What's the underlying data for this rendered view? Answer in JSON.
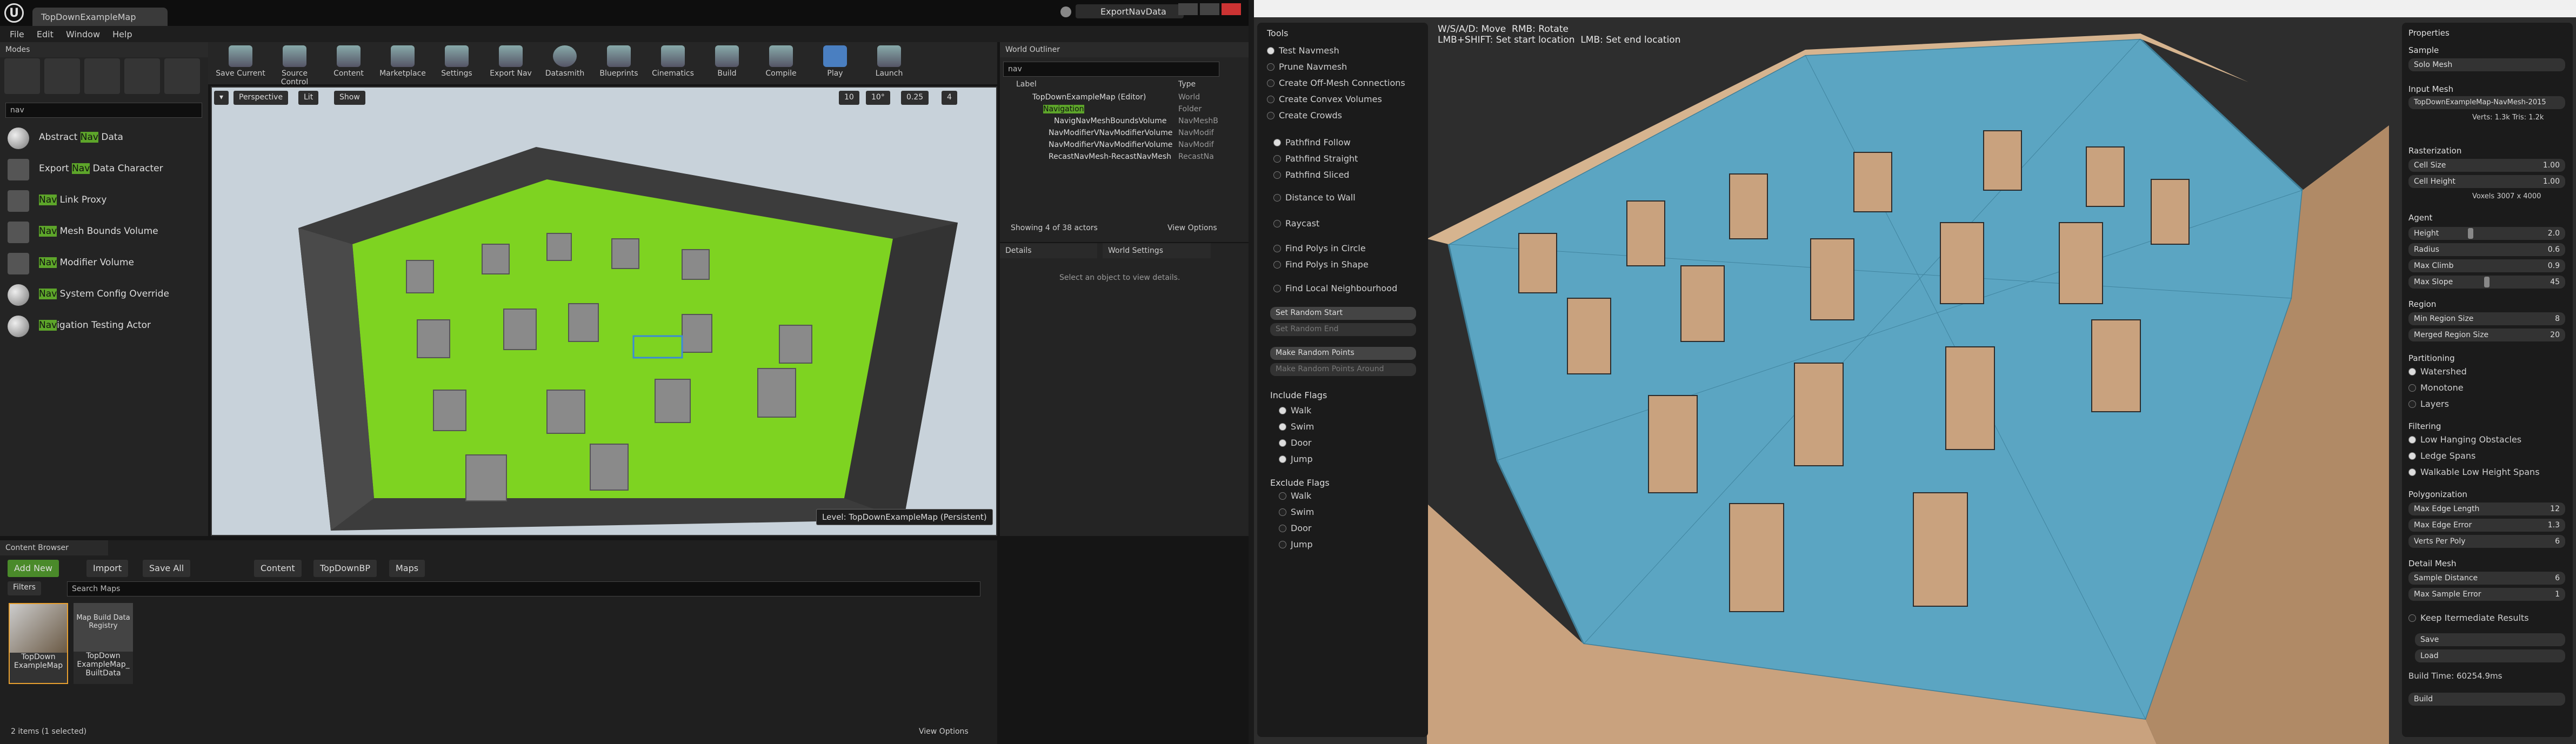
{
  "ue": {
    "tab": "TopDownExampleMap",
    "export_window": "ExportNavData",
    "menu": [
      "File",
      "Edit",
      "Window",
      "Help"
    ],
    "modes": {
      "title": "Modes",
      "search": "nav",
      "items": [
        {
          "pre": "Abstract ",
          "hl": "Nav",
          "post": " Data"
        },
        {
          "pre": "Export ",
          "hl": "Nav",
          "post": " Data Character"
        },
        {
          "pre": "",
          "hl": "Nav",
          "post": " Link Proxy"
        },
        {
          "pre": "",
          "hl": "Nav",
          "post": " Mesh Bounds Volume"
        },
        {
          "pre": "",
          "hl": "Nav",
          "post": " Modifier Volume"
        },
        {
          "pre": "",
          "hl": "Nav",
          "post": " System Config Override"
        },
        {
          "pre": "",
          "hl": "Nav",
          "post": "igation Testing Actor"
        }
      ]
    },
    "toolbar": [
      "Save Current",
      "Source Control",
      "Content",
      "Marketplace",
      "Settings",
      "Export Nav",
      "Datasmith",
      "Blueprints",
      "Cinematics",
      "Build",
      "Compile",
      "Play",
      "Launch"
    ],
    "viewport": {
      "perspective": "Perspective",
      "lit": "Lit",
      "show": "Show",
      "grid": "10",
      "angle": "10°",
      "scale": "0.25",
      "cam": "4",
      "level": "Level: TopDownExampleMap (Persistent)"
    },
    "outliner": {
      "title": "World Outliner",
      "search": "nav",
      "col_label": "Label",
      "col_type": "Type",
      "rows": [
        {
          "label": "TopDownExampleMap (Editor)",
          "type": "World"
        },
        {
          "label": "Navigation",
          "type": "Folder"
        },
        {
          "label": "NavigNavMeshBoundsVolume",
          "type": "NavMeshB"
        },
        {
          "label": "NavModifierVNavModifierVolume",
          "type": "NavModif"
        },
        {
          "label": "NavModifierVNavModifierVolume",
          "type": "NavModif"
        },
        {
          "label": "RecastNavMesh-RecastNavMesh",
          "type": "RecastNa"
        }
      ],
      "count": "Showing 4 of 38 actors",
      "view_options": "View Options"
    },
    "details": {
      "tab1": "Details",
      "tab2": "World Settings",
      "empty": "Select an object to view details."
    },
    "cb": {
      "title": "Content Browser",
      "add_new": "Add New",
      "import": "Import",
      "save_all": "Save All",
      "path": [
        "Content",
        "TopDownBP",
        "Maps"
      ],
      "filters": "Filters",
      "search": "Search Maps",
      "assets": [
        {
          "name": "TopDown ExampleMap",
          "thumb": "map"
        },
        {
          "name": "TopDown ExampleMap_ BuiltData",
          "thumb": "Map Build Data Registry"
        }
      ],
      "status": "2 items (1 selected)",
      "view_options": "View Options"
    }
  },
  "recast": {
    "hint": "W/S/A/D: Move  RMB: Rotate\nLMB+SHIFT: Set start location  LMB: Set end location",
    "tools": {
      "title": "Tools",
      "modes": [
        {
          "l": "Test Navmesh",
          "on": true
        },
        {
          "l": "Prune Navmesh",
          "on": false
        },
        {
          "l": "Create Off-Mesh Connections",
          "on": false
        },
        {
          "l": "Create Convex Volumes",
          "on": false
        },
        {
          "l": "Create Crowds",
          "on": false
        }
      ],
      "tests": [
        {
          "l": "Pathfind Follow",
          "on": true
        },
        {
          "l": "Pathfind Straight",
          "on": false
        },
        {
          "l": "Pathfind Sliced",
          "on": false
        },
        {
          "l": "Distance to Wall",
          "on": false
        },
        {
          "l": "Raycast",
          "on": false
        },
        {
          "l": "Find Polys in Circle",
          "on": false
        },
        {
          "l": "Find Polys in Shape",
          "on": false
        },
        {
          "l": "Find Local Neighbourhood",
          "on": false
        }
      ],
      "buttons": [
        {
          "l": "Set Random Start",
          "dim": false
        },
        {
          "l": "Set Random End",
          "dim": true
        },
        {
          "l": "Make Random Points",
          "dim": false
        },
        {
          "l": "Make Random Points Around",
          "dim": true
        }
      ],
      "include_title": "Include Flags",
      "include": [
        "Walk",
        "Swim",
        "Door",
        "Jump"
      ],
      "exclude_title": "Exclude Flags",
      "exclude": [
        "Walk",
        "Swim",
        "Door",
        "Jump"
      ]
    },
    "props": {
      "title": "Properties",
      "sample_title": "Sample",
      "sample": "Solo Mesh",
      "input_title": "Input Mesh",
      "input": "TopDownExampleMap-NavMesh-2015",
      "verts": "Verts: 1.3k  Tris: 1.2k",
      "raster_title": "Rasterization",
      "cell_size": {
        "l": "Cell Size",
        "v": "1.00"
      },
      "cell_height": {
        "l": "Cell Height",
        "v": "1.00"
      },
      "voxels": "Voxels  3007 x 4000",
      "agent_title": "Agent",
      "height": {
        "l": "Height",
        "v": "2.0"
      },
      "radius": {
        "l": "Radius",
        "v": "0.6"
      },
      "climb": {
        "l": "Max Climb",
        "v": "0.9"
      },
      "slope": {
        "l": "Max Slope",
        "v": "45"
      },
      "region_title": "Region",
      "min_region": {
        "l": "Min Region Size",
        "v": "8"
      },
      "merged": {
        "l": "Merged Region Size",
        "v": "20"
      },
      "part_title": "Partitioning",
      "part": [
        "Watershed",
        "Monotone",
        "Layers"
      ],
      "filter_title": "Filtering",
      "filters": [
        "Low Hanging Obstacles",
        "Ledge Spans",
        "Walkable Low Height Spans"
      ],
      "poly_title": "Polygonization",
      "edge_len": {
        "l": "Max Edge Length",
        "v": "12"
      },
      "edge_err": {
        "l": "Max Edge Error",
        "v": "1.3"
      },
      "vpp": {
        "l": "Verts Per Poly",
        "v": "6"
      },
      "detail_title": "Detail Mesh",
      "sample_dist": {
        "l": "Sample Distance",
        "v": "6"
      },
      "sample_err": {
        "l": "Max Sample Error",
        "v": "1"
      },
      "keep": "Keep Itermediate Results",
      "save": "Save",
      "load": "Load",
      "build_time": "Build Time: 60254.9ms",
      "build": "Build"
    }
  },
  "colors": {
    "ue_bg": "#151515",
    "nav_green": "#7ed321",
    "navmesh_blue": "#5ba5c2",
    "recast_wall": "#c9a27e",
    "accent_orange": "#e8a030"
  }
}
